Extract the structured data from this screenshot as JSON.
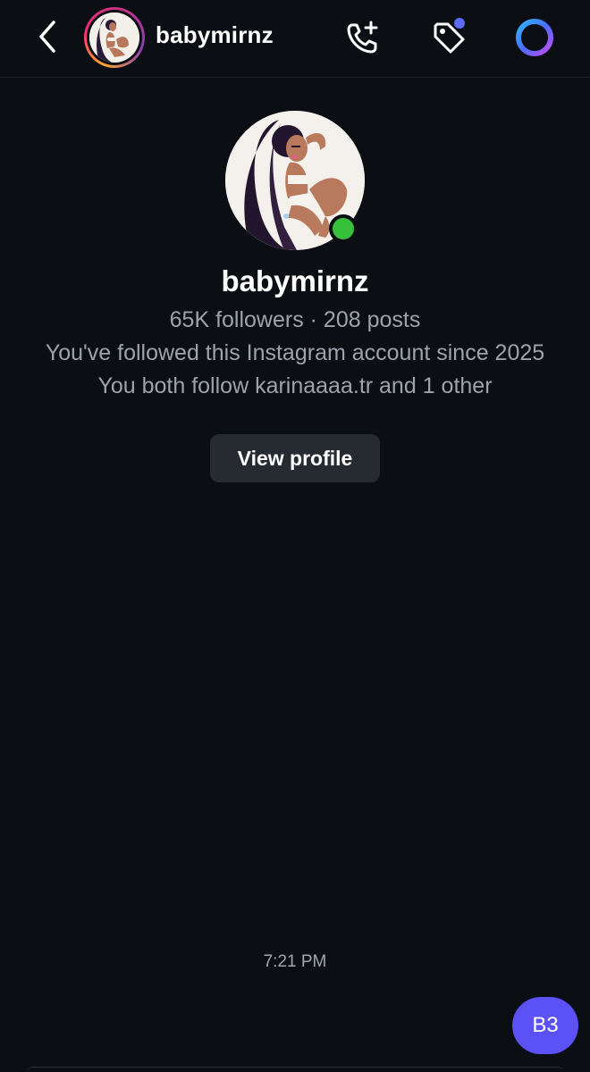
{
  "header": {
    "username": "babymirnz",
    "back_icon": "chevron-left-icon",
    "call_icon": "phone-add-icon",
    "tag_icon": "tag-icon",
    "ai_icon": "meta-ai-ring-icon",
    "notification_dot_color": "#5b6cf9"
  },
  "profile": {
    "name": "babymirnz",
    "stats": "65K followers · 208 posts",
    "followed_since": "You've followed this Instagram account since 2025",
    "mutuals": "You both follow karinaaaa.tr and 1 other",
    "view_profile_label": "View profile",
    "online_color": "#39c03b"
  },
  "conversation": {
    "timestamp": "7:21 PM",
    "message_bubble_text": "B3",
    "bubble_color": "#5b51f5"
  }
}
